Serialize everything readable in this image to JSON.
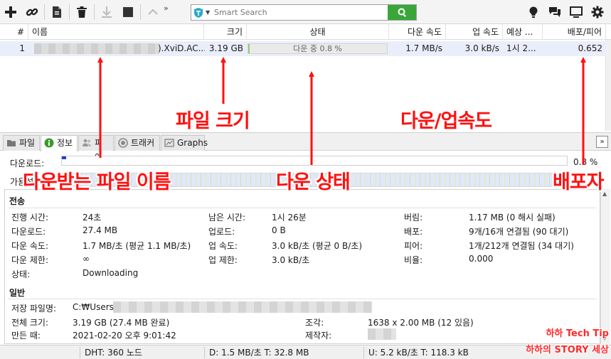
{
  "toolbar": {
    "search_placeholder": "Smart Search",
    "more_glyph": "»"
  },
  "columns": [
    {
      "label": "#"
    },
    {
      "label": "이름"
    },
    {
      "label": "크기"
    },
    {
      "label": "상태"
    },
    {
      "label": "다운 속도"
    },
    {
      "label": "업 속도"
    },
    {
      "label": "예상 ..."
    },
    {
      "label": "배포/피어"
    }
  ],
  "torrent": {
    "index": "1",
    "name_suffix": ").XviD.AC...",
    "size": "3.19 GB",
    "status": "다운 중 0.8 %",
    "progress_percent": 0.8,
    "down_speed": "1.7 MB/s",
    "up_speed": "3.0 kB/s",
    "eta": "1시 2...",
    "ratio": "0.652"
  },
  "tabs": [
    {
      "label": "파일"
    },
    {
      "label": "정보"
    },
    {
      "label": "피어"
    },
    {
      "label": "트래커"
    },
    {
      "label": "Graphs"
    }
  ],
  "collapse_glyph": "»",
  "progress": {
    "download_label": "다운로드:",
    "availability_label": "가용성:",
    "percent_text": "0.8 %",
    "percent_value": 0.8
  },
  "transfer": {
    "title": "전송",
    "rows": [
      [
        [
          "진행 시간:",
          "24초"
        ],
        [
          "남은 시간:",
          "1시 26분"
        ],
        [
          "버림:",
          "1.17 MB (0 해시 실패)"
        ]
      ],
      [
        [
          "다운로드:",
          "27.4 MB"
        ],
        [
          "업로드:",
          "0 B"
        ],
        [
          "배포:",
          "9개/16개 연결됨 (90 대기)"
        ]
      ],
      [
        [
          "다운 속도:",
          "1.7 MB/초 (평균 1.1 MB/초)"
        ],
        [
          "업 속도:",
          "3.0 kB/초 (평균 0 B/초)"
        ],
        [
          "피어:",
          "1개/212개 연결됨 (34 대기)"
        ]
      ],
      [
        [
          "다운 제한:",
          "∞"
        ],
        [
          "업 제한:",
          "3.0 kB/초"
        ],
        [
          "비율:",
          "0.000"
        ]
      ],
      [
        [
          "상태:",
          "Downloading"
        ]
      ]
    ]
  },
  "general": {
    "title": "일반",
    "save_path_label": "저장 파일명:",
    "save_path_value": "C:₩Users₩",
    "total_size_label": "전체 크기:",
    "total_size_value": "3.19 GB (27.4 MB 완료)",
    "pieces_label": "조각:",
    "pieces_value": "1638 x 2.00 MB (12 있음)",
    "created_label": "만든 때:",
    "created_value": "2021-02-20 오후 9:01:42",
    "creator_label": "제작자:"
  },
  "status_bar": {
    "dht": "DHT: 360 노드",
    "down": "D: 1.5 MB/초 T: 32.8 MB",
    "up": "U: 5.2 kB/초 T: 118.3 kB"
  },
  "annotations": {
    "file_name": "다운받는 파일 이름",
    "file_size": "파일 크기",
    "status": "다운 상태",
    "speed": "다운/업속도",
    "seeder": "배포자"
  },
  "watermark": {
    "line1": "하하 Tech Tip",
    "line2": "하하의 STORY 세상"
  },
  "colors": {
    "accent_green": "#3aa63a",
    "annotation_red": "#ff1010",
    "selected_row": "#e9eefa",
    "progress_fill": "#9acd6a"
  }
}
